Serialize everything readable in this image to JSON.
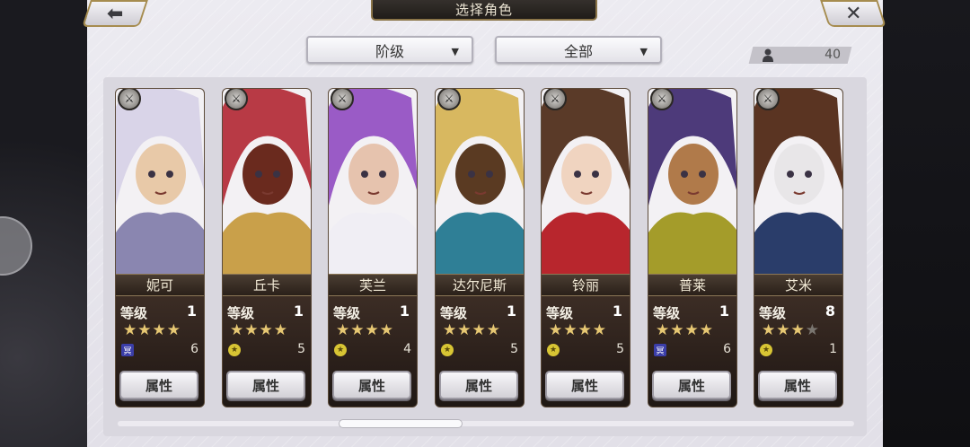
{
  "header": {
    "title": "选择角色",
    "back_icon": "left-arrow-icon",
    "close_icon": "x-icon",
    "back_glyph": "⬅",
    "close_glyph": "✕"
  },
  "filters": {
    "rank_label": "阶级",
    "category_label": "全部",
    "arrow": "▼"
  },
  "party_count": "40",
  "cards": [
    {
      "name": "妮可",
      "level_label": "等级",
      "level": "1",
      "stars": 4,
      "max_stars": 4,
      "element": "dark",
      "element_glyph": "冥",
      "sub_value": "6",
      "button": "属性",
      "portrait_colors": [
        "#d9d4e8",
        "#8a86b0",
        "#e8c9a8"
      ]
    },
    {
      "name": "丘卡",
      "level_label": "等级",
      "level": "1",
      "stars": 4,
      "max_stars": 4,
      "element": "light",
      "element_glyph": "★",
      "sub_value": "5",
      "button": "属性",
      "portrait_colors": [
        "#b83a45",
        "#c9a04a",
        "#6a2a1e"
      ]
    },
    {
      "name": "芙兰",
      "level_label": "等级",
      "level": "1",
      "stars": 4,
      "max_stars": 4,
      "element": "light",
      "element_glyph": "★",
      "sub_value": "4",
      "button": "属性",
      "portrait_colors": [
        "#9a5bc6",
        "#f0eef4",
        "#e6c3ae"
      ]
    },
    {
      "name": "达尔尼斯",
      "level_label": "等级",
      "level": "1",
      "stars": 4,
      "max_stars": 4,
      "element": "light",
      "element_glyph": "★",
      "sub_value": "5",
      "button": "属性",
      "portrait_colors": [
        "#d8b860",
        "#2f7f96",
        "#5a3a22"
      ]
    },
    {
      "name": "铃丽",
      "level_label": "等级",
      "level": "1",
      "stars": 4,
      "max_stars": 4,
      "element": "light",
      "element_glyph": "★",
      "sub_value": "5",
      "button": "属性",
      "portrait_colors": [
        "#5a3a28",
        "#b8262d",
        "#f0d4c0"
      ]
    },
    {
      "name": "普莱",
      "level_label": "等级",
      "level": "1",
      "stars": 4,
      "max_stars": 4,
      "element": "dark",
      "element_glyph": "冥",
      "sub_value": "6",
      "button": "属性",
      "portrait_colors": [
        "#4d3a7a",
        "#a49c2a",
        "#b07a4a"
      ]
    },
    {
      "name": "艾米",
      "level_label": "等级",
      "level": "8",
      "stars": 3,
      "max_stars": 4,
      "element": "light",
      "element_glyph": "★",
      "sub_value": "1",
      "button": "属性",
      "portrait_colors": [
        "#5a3422",
        "#2a3d6a",
        "#e8e6e8"
      ]
    }
  ],
  "class_icon_names": [
    "bow-class-icon",
    "axe-class-icon",
    "spear-class-icon",
    "sword-class-icon",
    "fist-class-icon",
    "book-class-icon",
    "hammer-class-icon"
  ],
  "scroll": {
    "position": 0.36
  }
}
